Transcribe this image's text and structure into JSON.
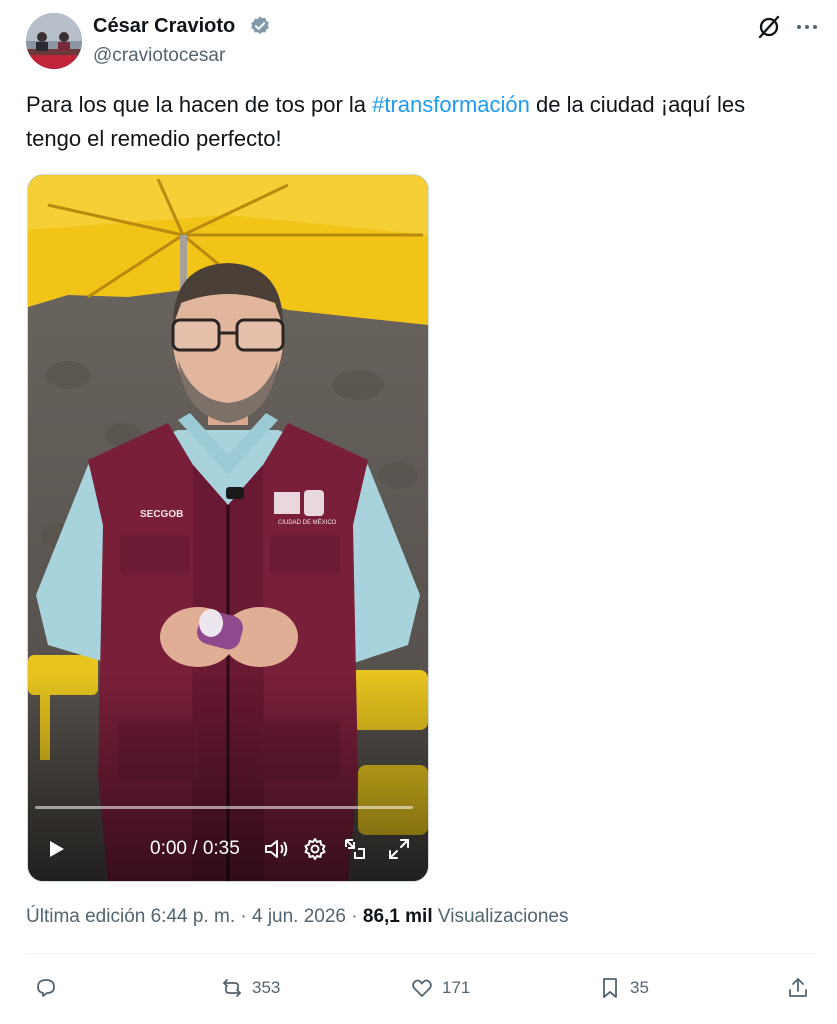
{
  "author": {
    "name": "César Cravioto",
    "handle": "@craviotocesar"
  },
  "tweet": {
    "text_before": "Para los que la hacen de tos por la ",
    "hashtag": "#transformación",
    "text_after": " de la ciudad ¡aquí les tengo el remedio perfecto!"
  },
  "video": {
    "time": "0:00 / 0:35",
    "vest_label": "SECGOB",
    "vest_logo_text": "CIUDAD DE MÉXICO"
  },
  "meta": {
    "edited_label": "Última edición 6:44 p. m. · 4 jun. 2026 · ",
    "views_count": "86,1 mil",
    "views_label": " Visualizaciones"
  },
  "actions": {
    "reply_count": "",
    "retweet_count": "353",
    "like_count": "171",
    "bookmark_count": "35"
  },
  "colors": {
    "accent": "#1d9bf0",
    "verified": "#829aab",
    "umbrella": "#f2c418",
    "vest": "#7a1f3a",
    "shirt": "#a9d3dc"
  }
}
